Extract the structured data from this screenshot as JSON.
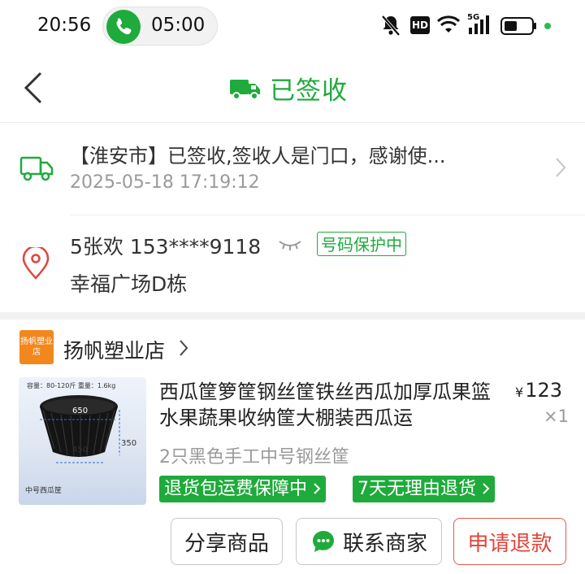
{
  "status_bar": {
    "time": "20:56",
    "call_timer": "05:00",
    "icons": [
      "phone-icon",
      "mute-bell-icon",
      "hd-icon",
      "wifi-icon",
      "signal-5g-icon",
      "battery-icon",
      "dot-indicator-icon"
    ],
    "hd_label": "HD",
    "network_label": "5G"
  },
  "header": {
    "title": "已签收",
    "icons": [
      "back-arrow-icon",
      "delivery-truck-icon"
    ]
  },
  "logistics": {
    "status_text": "【淮安市】已签收,签收人是门口，感谢使...",
    "timestamp": "2025-05-18 17:19:12"
  },
  "address": {
    "name_phone": "5张欢  153****9118",
    "privacy_badge": "号码保护中",
    "address_line": "幸福广场D栋"
  },
  "shop": {
    "logo_text": "扬帆塑业店",
    "name": "扬帆塑业店"
  },
  "product": {
    "title": "西瓜筐箩筐钢丝筐铁丝西瓜加厚瓜果篮水果蔬果收纳筐大棚装西瓜运",
    "price_symbol": "¥",
    "price": "123",
    "quantity": "×1",
    "spec": "2只黑色手工中号钢丝筐",
    "tags": [
      "退货包运费保障中",
      "7天无理由退货"
    ],
    "image_labels": {
      "capacity": "容量：80-120斤 重量：1.6kg",
      "dim_top": "650",
      "dim_height": "350",
      "dim_bottom": "450",
      "caption": "中号西瓜筐"
    }
  },
  "actions": {
    "share": "分享商品",
    "contact": "联系商家",
    "refund": "申请退款"
  },
  "colors": {
    "accent_green": "#1faa3c",
    "refund_red": "#e0453a",
    "shop_orange": "#f2871e"
  }
}
